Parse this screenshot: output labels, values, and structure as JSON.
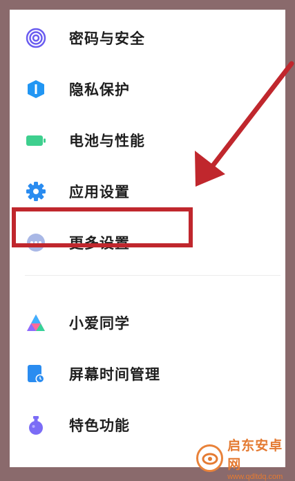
{
  "menu": {
    "items": [
      {
        "label": "密码与安全",
        "icon": "fingerprint-icon"
      },
      {
        "label": "隐私保护",
        "icon": "privacy-shield-icon"
      },
      {
        "label": "电池与性能",
        "icon": "battery-icon"
      },
      {
        "label": "应用设置",
        "icon": "gear-icon"
      },
      {
        "label": "更多设置",
        "icon": "more-dots-icon"
      },
      {
        "label": "小爱同学",
        "icon": "xiaoai-icon"
      },
      {
        "label": "屏幕时间管理",
        "icon": "screen-time-icon"
      },
      {
        "label": "特色功能",
        "icon": "flask-icon"
      }
    ]
  },
  "annotation": {
    "highlight_color": "#c0272d",
    "target": "更多设置"
  },
  "watermark": {
    "title": "启东安卓网",
    "url": "www.qdltdq.com"
  },
  "colors": {
    "fingerprint": "#6a5cf0",
    "shield": "#2196f3",
    "battery": "#3ecf8e",
    "gear": "#2a8cf0",
    "more": "#a9b8e6",
    "flask": "#7b6cf6"
  }
}
